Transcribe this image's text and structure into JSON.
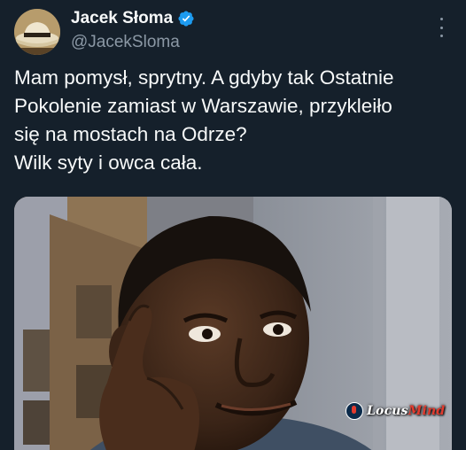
{
  "author": {
    "display_name": "Jacek Słoma",
    "handle": "@JacekSloma",
    "verified": true,
    "avatar_icon": "hat-avatar-icon"
  },
  "tweet": {
    "text_lines": [
      "Mam pomysł, sprytny. A gdyby tak Ostatnie",
      "Pokolenie zamiast w Warszawie, przykleiło",
      "się na mostach na Odrze?",
      "Wilk syty i owca cała."
    ]
  },
  "media": {
    "description_icon": "roll-safe-meme-image",
    "watermark": {
      "part1": "Locus",
      "part2": "Mind"
    }
  },
  "colors": {
    "background": "#15202b",
    "text": "#f7f9f9",
    "secondary_text": "#8b98a5",
    "verified_badge": "#1d9bf0",
    "watermark_accent": "#e23b2e"
  }
}
